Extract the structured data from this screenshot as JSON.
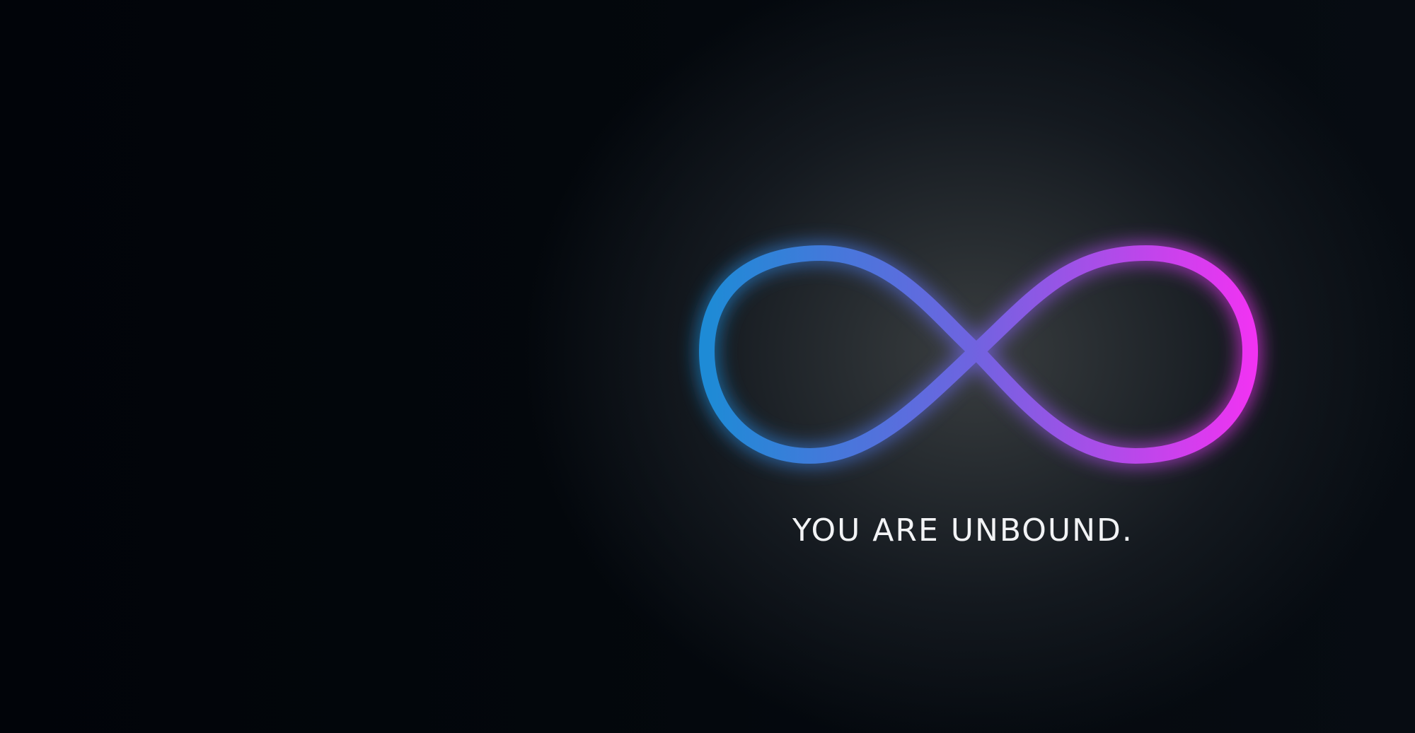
{
  "tagline": "YOU ARE UNBOUND.",
  "symbol": {
    "icon": "infinity-icon",
    "gradient_start": "#1e8bd6",
    "gradient_mid": "#6e64e0",
    "gradient_end": "#f033f2"
  },
  "colors": {
    "background": "#03070c",
    "text": "#f2f3f5"
  }
}
